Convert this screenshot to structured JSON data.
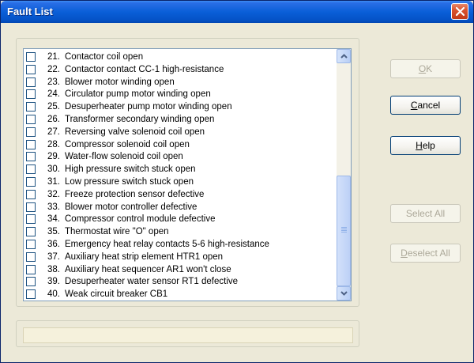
{
  "window": {
    "title": "Fault List"
  },
  "faults": [
    {
      "num": "21.",
      "label": "Contactor coil open"
    },
    {
      "num": "22.",
      "label": "Contactor contact CC-1 high-resistance"
    },
    {
      "num": "23.",
      "label": "Blower motor winding open"
    },
    {
      "num": "24.",
      "label": "Circulator pump motor winding open"
    },
    {
      "num": "25.",
      "label": "Desuperheater pump motor winding open"
    },
    {
      "num": "26.",
      "label": "Transformer secondary winding open"
    },
    {
      "num": "27.",
      "label": "Reversing valve solenoid coil open"
    },
    {
      "num": "28.",
      "label": "Compressor solenoid coil open"
    },
    {
      "num": "29.",
      "label": "Water-flow solenoid coil open"
    },
    {
      "num": "30.",
      "label": "High pressure switch stuck open"
    },
    {
      "num": "31.",
      "label": "Low pressure switch stuck open"
    },
    {
      "num": "32.",
      "label": "Freeze protection sensor defective"
    },
    {
      "num": "33.",
      "label": "Blower motor controller defective"
    },
    {
      "num": "34.",
      "label": "Compressor control module defective"
    },
    {
      "num": "35.",
      "label": "Thermostat wire \"O\" open"
    },
    {
      "num": "36.",
      "label": "Emergency heat relay contacts 5-6 high-resistance"
    },
    {
      "num": "37.",
      "label": "Auxiliary heat strip element HTR1 open"
    },
    {
      "num": "38.",
      "label": "Auxiliary heat sequencer AR1 won't close"
    },
    {
      "num": "39.",
      "label": "Desuperheater water sensor RT1 defective"
    },
    {
      "num": "40.",
      "label": "Weak circuit breaker CB1"
    }
  ],
  "buttons": {
    "ok": {
      "access": "O",
      "rest": "K",
      "enabled": false
    },
    "cancel": {
      "access": "C",
      "rest": "ancel",
      "enabled": true
    },
    "help": {
      "access": "H",
      "rest": "elp",
      "enabled": true
    },
    "select_all": {
      "label": "Select All",
      "enabled": false
    },
    "deselect_all": {
      "access": "D",
      "rest": "eselect All",
      "enabled": false
    }
  },
  "colors": {
    "titlebar": "#0553c8",
    "close_button": "#d9532f",
    "status_field": "#f5f1dc"
  },
  "icons": {
    "close": "close-icon",
    "scroll_up": "chevron-up-icon",
    "scroll_down": "chevron-down-icon"
  }
}
